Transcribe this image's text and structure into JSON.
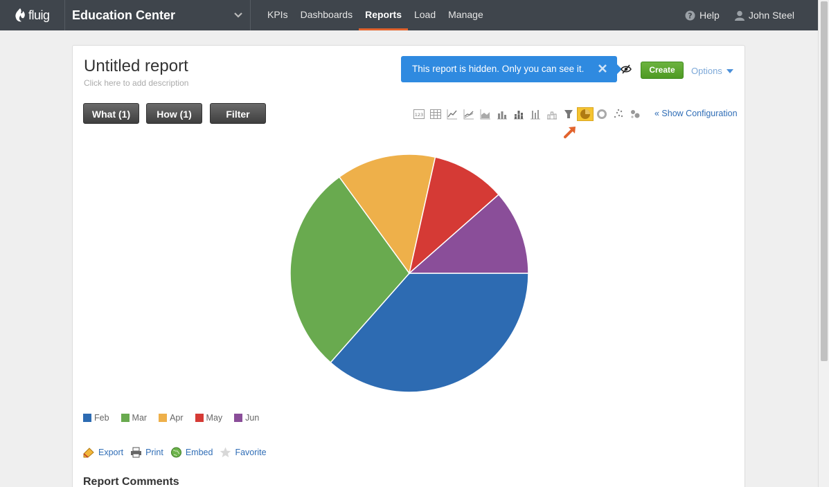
{
  "app": {
    "logo_text": "fluig",
    "org_title": "Education Center"
  },
  "nav": {
    "items": [
      {
        "label": "KPIs"
      },
      {
        "label": "Dashboards"
      },
      {
        "label": "Reports",
        "active": true
      },
      {
        "label": "Load"
      },
      {
        "label": "Manage"
      }
    ],
    "help": "Help",
    "user": "John Steel"
  },
  "report": {
    "title": "Untitled report",
    "description_placeholder": "Click here to add description",
    "hidden_notice": "This report is hidden. Only you can see it.",
    "create_label": "Create",
    "options_label": "Options",
    "what_label": "What (1)",
    "how_label": "How (1)",
    "filter_label": "Filter",
    "show_config": "« Show Configuration",
    "chart_type_icons": [
      "number-icon",
      "table-icon",
      "line-icon",
      "line-markers-icon",
      "area-icon",
      "bar-icon",
      "stacked-bar-icon",
      "column-icon",
      "waterfall-icon",
      "funnel-icon",
      "pie-icon",
      "donut-icon",
      "scatter-icon",
      "bubble-icon"
    ],
    "selected_chart_type": "pie-icon"
  },
  "chart_data": {
    "type": "pie",
    "categories": [
      "Feb",
      "Mar",
      "Apr",
      "May",
      "Jun"
    ],
    "values": [
      36.5,
      28.5,
      13.5,
      10,
      11.5
    ],
    "colors": [
      "#2d6bb2",
      "#69aa4f",
      "#eeb04a",
      "#d53a35",
      "#8a4e99"
    ],
    "legend": "bottom-left"
  },
  "actions": {
    "export": "Export",
    "print": "Print",
    "embed": "Embed",
    "favorite": "Favorite"
  },
  "comments_title": "Report Comments"
}
